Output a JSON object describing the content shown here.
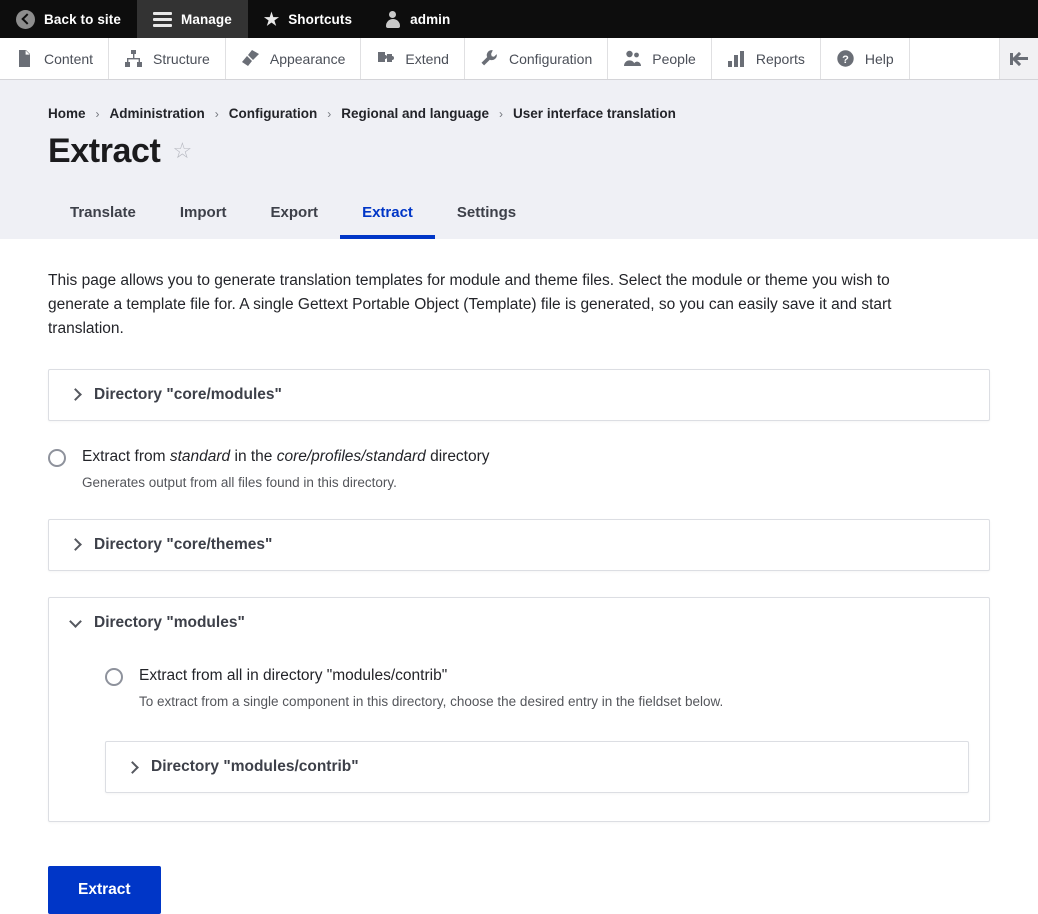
{
  "toolbar": {
    "tabs": [
      {
        "label": "Back to site",
        "icon": "back-arrow-icon",
        "active": false
      },
      {
        "label": "Manage",
        "icon": "hamburger-icon",
        "active": true
      },
      {
        "label": "Shortcuts",
        "icon": "star-icon",
        "active": false
      },
      {
        "label": "admin",
        "icon": "user-icon",
        "active": false
      }
    ]
  },
  "admin_menu": {
    "items": [
      {
        "label": "Content",
        "icon": "document-icon"
      },
      {
        "label": "Structure",
        "icon": "structure-icon"
      },
      {
        "label": "Appearance",
        "icon": "paintbrush-icon"
      },
      {
        "label": "Extend",
        "icon": "puzzle-piece-icon"
      },
      {
        "label": "Configuration",
        "icon": "wrench-icon"
      },
      {
        "label": "People",
        "icon": "people-icon"
      },
      {
        "label": "Reports",
        "icon": "bar-chart-icon"
      },
      {
        "label": "Help",
        "icon": "question-mark-icon"
      }
    ],
    "orientation_toggle_icon": "vertical-orientation-icon"
  },
  "breadcrumb": [
    "Home",
    "Administration",
    "Configuration",
    "Regional and language",
    "User interface translation"
  ],
  "breadcrumb_separator": "›",
  "header": {
    "title": "Extract",
    "favorite_icon": "star-outline-icon",
    "favorite_glyph": "☆"
  },
  "tabs": [
    {
      "label": "Translate",
      "active": false
    },
    {
      "label": "Import",
      "active": false
    },
    {
      "label": "Export",
      "active": false
    },
    {
      "label": "Extract",
      "active": true
    },
    {
      "label": "Settings",
      "active": false
    }
  ],
  "main": {
    "intro": "This page allows you to generate translation templates for module and theme files. Select the module or theme you wish to generate a template file for. A single Gettext Portable Object (Template) file is generated, so you can easily save it and start translation.",
    "details_core_modules": {
      "summary": "Directory \"core/modules\"",
      "expanded": false,
      "chevron_icon": "chevron-right-icon"
    },
    "standard_radio": {
      "label_prefix": "Extract from ",
      "label_em1": "standard",
      "label_mid": " in the ",
      "label_em2": "core/profiles/standard",
      "label_suffix": " directory",
      "description": "Generates output from all files found in this directory.",
      "checked": false
    },
    "details_core_themes": {
      "summary": "Directory \"core/themes\"",
      "expanded": false,
      "chevron_icon": "chevron-right-icon"
    },
    "details_modules": {
      "summary": "Directory \"modules\"",
      "expanded": true,
      "chevron_icon": "chevron-down-icon",
      "radio": {
        "label": "Extract from all in directory \"modules/contrib\"",
        "description": "To extract from a single component in this directory, choose the desired entry in the fieldset below.",
        "checked": false
      },
      "nested_details": {
        "summary": "Directory \"modules/contrib\"",
        "expanded": false,
        "chevron_icon": "chevron-right-icon"
      }
    },
    "submit_label": "Extract"
  },
  "colors": {
    "primary": "#0036c7",
    "toolbar_bg": "#0d0d0d",
    "toolbar_active_bg": "#333333",
    "header_bg": "#eff0f5",
    "border": "#dcdee3",
    "text": "#232429"
  }
}
